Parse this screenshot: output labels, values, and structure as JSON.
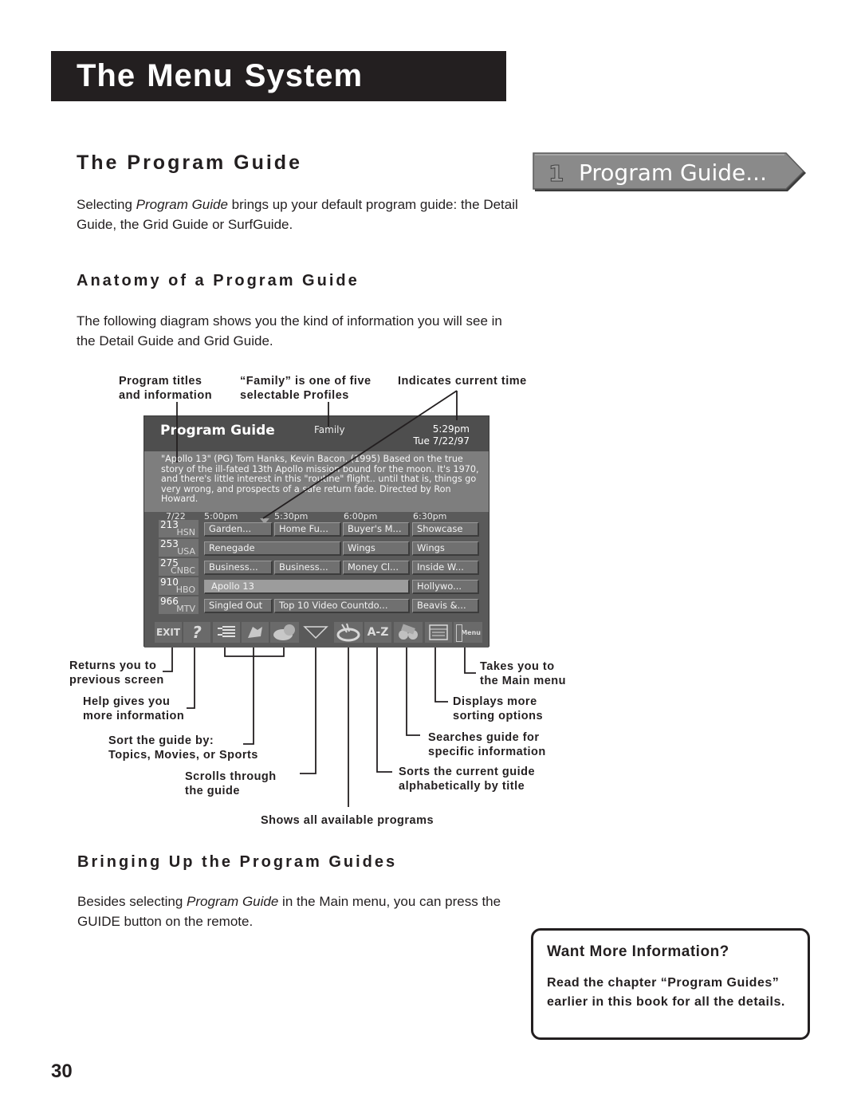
{
  "chapter_title": "The Menu System",
  "section1": {
    "title": "The Program Guide",
    "para_prefix": "Selecting ",
    "para_italic": "Program Guide",
    "para_suffix": " brings up your default program guide: the Detail Guide, the Grid Guide or SurfGuide.",
    "menu_button": {
      "number": "1",
      "label": "Program Guide..."
    }
  },
  "section2": {
    "title": "Anatomy of a Program Guide",
    "para": "The following diagram shows you the kind of information you will see in the Detail Guide and Grid Guide."
  },
  "annotations": {
    "program_titles": [
      "Program titles",
      "and information"
    ],
    "family_profile": [
      "“Family” is one of five",
      "selectable Profiles"
    ],
    "current_time": [
      "Indicates current time"
    ],
    "returns": [
      "Returns you to",
      "previous screen"
    ],
    "help": [
      "Help gives you",
      "more information"
    ],
    "sort_by": [
      "Sort the guide by:",
      "Topics, Movies, or Sports"
    ],
    "scrolls": [
      "Scrolls through",
      "the guide"
    ],
    "shows_all": [
      "Shows all available programs"
    ],
    "sorts_alpha": [
      "Sorts the current guide",
      "alphabetically by title"
    ],
    "searches": [
      "Searches guide for",
      "specific information"
    ],
    "more_sorting": [
      "Displays more",
      "sorting options"
    ],
    "main_menu": [
      "Takes you to",
      "the Main menu"
    ]
  },
  "guide_screen": {
    "title": "Program Guide",
    "profile": "Family",
    "time": "5:29pm",
    "date": "Tue 7/22/97",
    "description": "\"Apollo 13\" (PG) Tom Hanks, Kevin Bacon. (1995) Based on the true story of the ill-fated 13th Apollo mission bound for the moon. It's 1970, and there's little interest in this \"routine\" flight.. until that is, things go very wrong, and prospects of a safe return fade. Directed by Ron Howard.",
    "grid_date": "7/22",
    "time_slots": [
      "5:00pm",
      "5:30pm",
      "6:00pm",
      "6:30pm"
    ],
    "channels": [
      {
        "number": "213",
        "network": "HSN",
        "programs": [
          "Garden...",
          "Home Fu...",
          "Buyer's M...",
          "Showcase"
        ]
      },
      {
        "number": "253",
        "network": "USA",
        "programs": [
          "Renegade",
          "Wings",
          "Wings"
        ]
      },
      {
        "number": "275",
        "network": "CNBC",
        "programs": [
          "Business...",
          "Business...",
          "Money Cl...",
          "Inside W..."
        ]
      },
      {
        "number": "910",
        "network": "HBO",
        "programs": [
          "Apollo 13",
          "Hollywo..."
        ]
      },
      {
        "number": "966",
        "network": "MTV",
        "programs": [
          "Singled Out",
          "Top 10 Video Countdo...",
          "Beavis &..."
        ]
      }
    ],
    "toolbar": [
      {
        "icon": "exit-icon",
        "label": "EXIT"
      },
      {
        "icon": "help-icon",
        "label": "?"
      },
      {
        "icon": "list-scroll-icon",
        "label": ""
      },
      {
        "icon": "topics-icon",
        "label": ""
      },
      {
        "icon": "movies-sports-icon",
        "label": ""
      },
      {
        "icon": "down-triangle-icon",
        "label": ""
      },
      {
        "icon": "all-programs-icon",
        "label": ""
      },
      {
        "icon": "az-sort-icon",
        "label": "A-Z"
      },
      {
        "icon": "binoculars-search-icon",
        "label": ""
      },
      {
        "icon": "sort-options-icon",
        "label": ""
      },
      {
        "icon": "main-menu-icon",
        "label": "Menu"
      }
    ]
  },
  "section3": {
    "title": "Bringing Up the Program Guides",
    "para_prefix": "Besides selecting ",
    "para_italic": "Program Guide",
    "para_suffix": " in the Main menu, you can press the GUIDE button on the remote."
  },
  "info_box": {
    "title": "Want More Information?",
    "text": "Read the chapter “Program Guides” earlier in this book for all the details."
  },
  "page_number": "30"
}
